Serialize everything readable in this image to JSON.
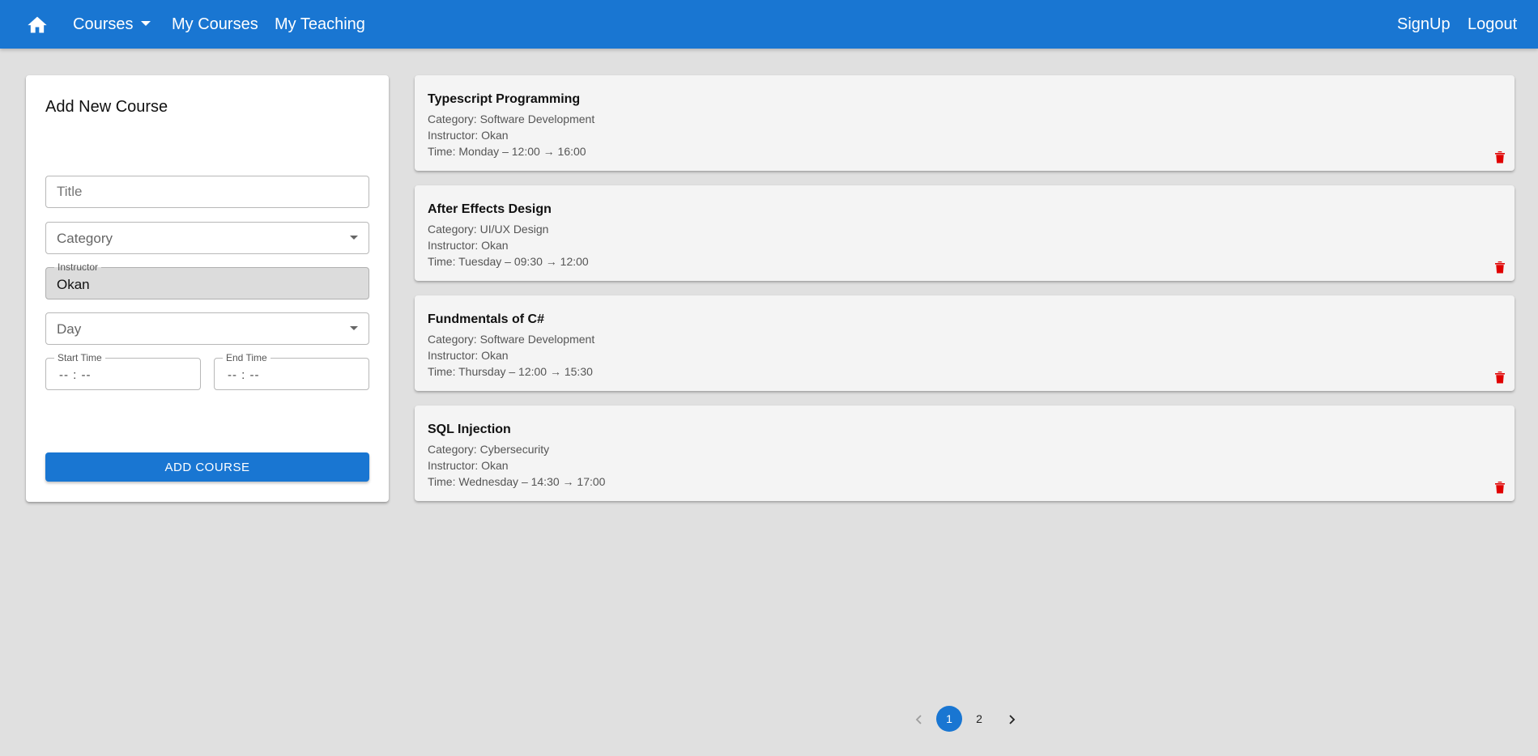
{
  "appbar": {
    "color": "#1976d2",
    "home_icon": "home-icon",
    "nav": {
      "courses": "Courses",
      "my_courses": "My Courses",
      "my_teaching": "My Teaching",
      "signup": "SignUp",
      "logout": "Logout"
    }
  },
  "form": {
    "title": "Add New Course",
    "title_placeholder": "Title",
    "category_placeholder": "Category",
    "instructor_label": "Instructor",
    "instructor_value": "Okan",
    "day_placeholder": "Day",
    "start_time_label": "Start Time",
    "start_time_value": "-- : --",
    "end_time_label": "End Time",
    "end_time_value": "-- : --",
    "submit_label": "ADD COURSE"
  },
  "courses": [
    {
      "title": "Typescript Programming",
      "category": "Category: Software Development",
      "instructor": "Instructor: Okan",
      "time": "Time: Monday – 12:00 → 16:00"
    },
    {
      "title": "After Effects Design",
      "category": "Category: UI/UX Design",
      "instructor": "Instructor: Okan",
      "time": "Time: Tuesday – 09:30 → 12:00"
    },
    {
      "title": "Fundmentals of C#",
      "category": "Category: Software Development",
      "instructor": "Instructor: Okan",
      "time": "Time: Thursday – 12:00 → 15:30"
    },
    {
      "title": "SQL Injection",
      "category": "Category: Cybersecurity",
      "instructor": "Instructor: Okan",
      "time": "Time: Wednesday – 14:30 → 17:00"
    }
  ],
  "delete_icon": "trash-icon",
  "delete_color": "#e00000",
  "pagination": {
    "pages": [
      "1",
      "2"
    ],
    "current": "1"
  }
}
